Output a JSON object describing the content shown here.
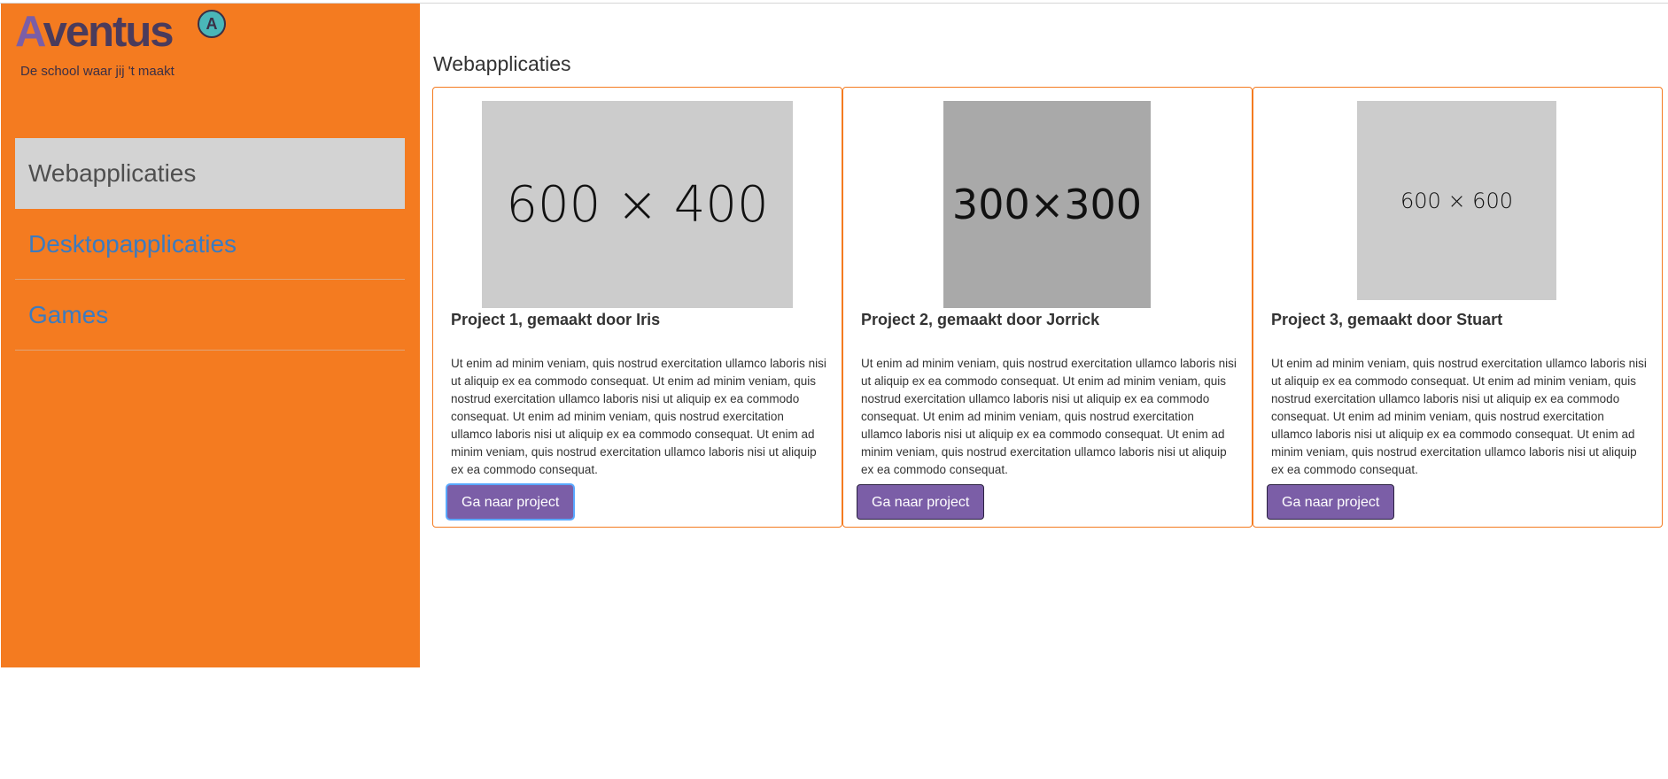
{
  "branding": {
    "logo_cap": "A",
    "logo_rest": "ventus",
    "logo_badge": "A",
    "tagline": "De school waar jij 't maakt"
  },
  "colors": {
    "sidebar": "#f47b20",
    "accent": "#7b5ea7",
    "nav_link": "#3b7bc0",
    "active_bg": "#d3d3d3"
  },
  "sidebar": {
    "items": [
      {
        "label": "Webapplicaties",
        "active": true
      },
      {
        "label": "Desktopapplicaties",
        "active": false
      },
      {
        "label": "Games",
        "active": false
      }
    ]
  },
  "main": {
    "title": "Webapplicaties",
    "cards": [
      {
        "image_label": "600 × 400",
        "title": "Project 1, gemaakt door Iris",
        "text": "Ut enim ad minim veniam, quis nostrud exercitation ullamco laboris nisi ut aliquip ex ea commodo consequat. Ut enim ad minim veniam, quis nostrud exercitation ullamco laboris nisi ut aliquip ex ea commodo consequat. Ut enim ad minim veniam, quis nostrud exercitation ullamco laboris nisi ut aliquip ex ea commodo consequat. Ut enim ad minim veniam, quis nostrud exercitation ullamco laboris nisi ut aliquip ex ea commodo consequat.",
        "button": "Ga naar project"
      },
      {
        "image_label": "300×300",
        "title": "Project 2, gemaakt door Jorrick",
        "text": "Ut enim ad minim veniam, quis nostrud exercitation ullamco laboris nisi ut aliquip ex ea commodo consequat. Ut enim ad minim veniam, quis nostrud exercitation ullamco laboris nisi ut aliquip ex ea commodo consequat. Ut enim ad minim veniam, quis nostrud exercitation ullamco laboris nisi ut aliquip ex ea commodo consequat. Ut enim ad minim veniam, quis nostrud exercitation ullamco laboris nisi ut aliquip ex ea commodo consequat.",
        "button": "Ga naar project"
      },
      {
        "image_label": "600 × 600",
        "title": "Project 3, gemaakt door Stuart",
        "text": "Ut enim ad minim veniam, quis nostrud exercitation ullamco laboris nisi ut aliquip ex ea commodo consequat. Ut enim ad minim veniam, quis nostrud exercitation ullamco laboris nisi ut aliquip ex ea commodo consequat. Ut enim ad minim veniam, quis nostrud exercitation ullamco laboris nisi ut aliquip ex ea commodo consequat. Ut enim ad minim veniam, quis nostrud exercitation ullamco laboris nisi ut aliquip ex ea commodo consequat.",
        "button": "Ga naar project"
      }
    ]
  }
}
